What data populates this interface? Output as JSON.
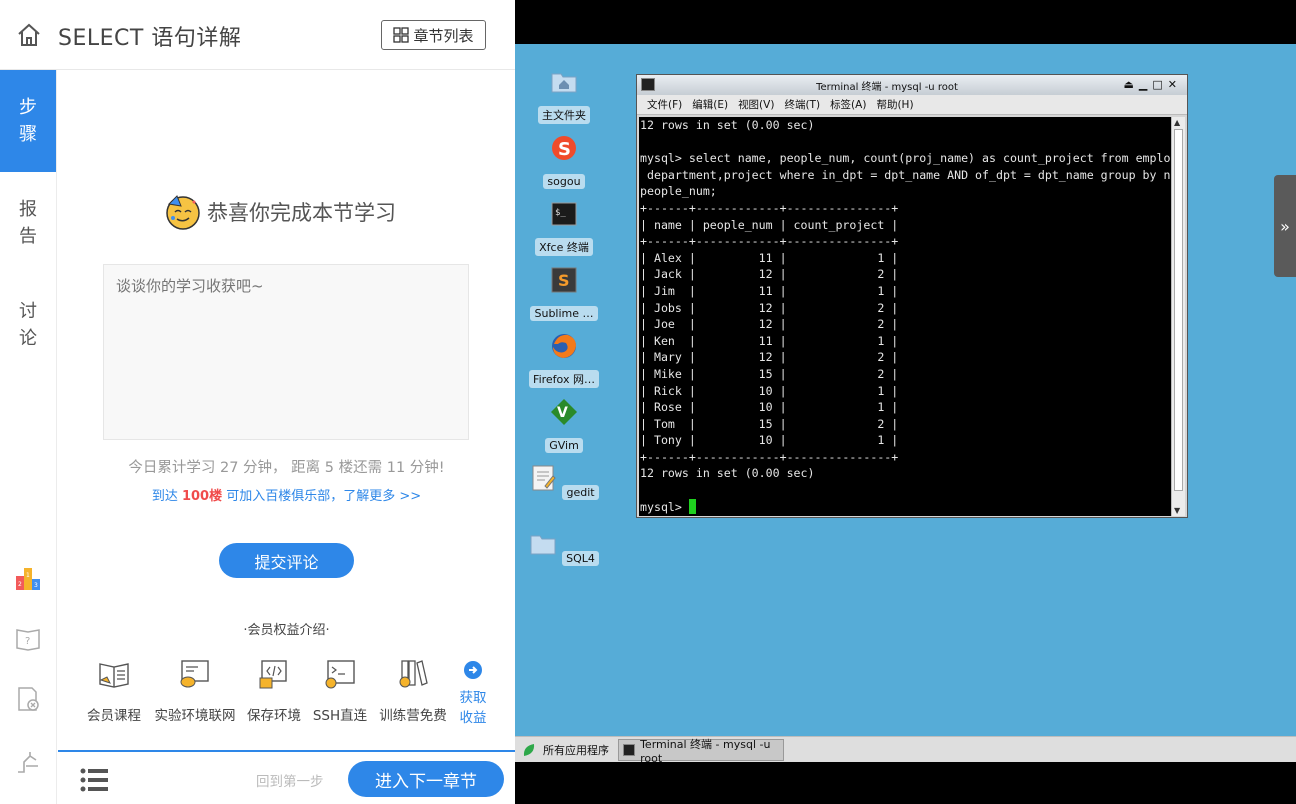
{
  "header": {
    "title": "SELECT 语句详解",
    "chapter_list_label": "章节列表"
  },
  "sidenav": {
    "tabs": [
      "步骤",
      "报告",
      "讨论"
    ]
  },
  "main": {
    "congrats": "恭喜你完成本节学习",
    "comment_placeholder": "谈谈你的学习收获吧~",
    "stat_line": "今日累计学习 27 分钟， 距离 5 楼还需 11 分钟!",
    "club_prefix": "到达 ",
    "club_floor": "100楼",
    "club_suffix": " 可加入百楼俱乐部，了解更多 >>",
    "submit_label": "提交评论",
    "member_title": "·会员权益介绍·",
    "perks": [
      "会员课程",
      "实验环境联网",
      "保存环境",
      "SSH直连",
      "训练营免费"
    ],
    "get_benefit": [
      "获取",
      "收益"
    ]
  },
  "footer": {
    "back_first": "回到第一步",
    "next_chapter": "进入下一章节"
  },
  "desktop": {
    "icons": [
      "主文件夹",
      "sogou",
      "Xfce 终端",
      "Sublime …",
      "Firefox 网…",
      "GVim",
      "gedit",
      "SQL4"
    ],
    "expander_glyph": "»"
  },
  "terminal": {
    "title": "Terminal 终端 - mysql -u root",
    "menu": [
      "文件(F)",
      "编辑(E)",
      "视图(V)",
      "终端(T)",
      "标签(A)",
      "帮助(H)"
    ],
    "lines": [
      "12 rows in set (0.00 sec)",
      "",
      "mysql> select name, people_num, count(proj_name) as count_project from employee,",
      " department,project where in_dpt = dpt_name AND of_dpt = dpt_name group by name,",
      "people_num;",
      "+------+------------+---------------+",
      "| name | people_num | count_project |",
      "+------+------------+---------------+",
      "| Alex |         11 |             1 |",
      "| Jack |         12 |             2 |",
      "| Jim  |         11 |             1 |",
      "| Jobs |         12 |             2 |",
      "| Joe  |         12 |             2 |",
      "| Ken  |         11 |             1 |",
      "| Mary |         12 |             2 |",
      "| Mike |         15 |             2 |",
      "| Rick |         10 |             1 |",
      "| Rose |         10 |             1 |",
      "| Tom  |         15 |             2 |",
      "| Tony |         10 |             1 |",
      "+------+------------+---------------+",
      "12 rows in set (0.00 sec)",
      ""
    ],
    "prompt": "mysql> "
  },
  "taskbar": {
    "apps_label": "所有应用程序",
    "window_label": "Terminal 终端 - mysql -u root"
  },
  "colors": {
    "accent": "#2e87e8",
    "desktop": "#56acd7",
    "highlight": "#f04b4b",
    "cursor": "#1fd01f"
  }
}
